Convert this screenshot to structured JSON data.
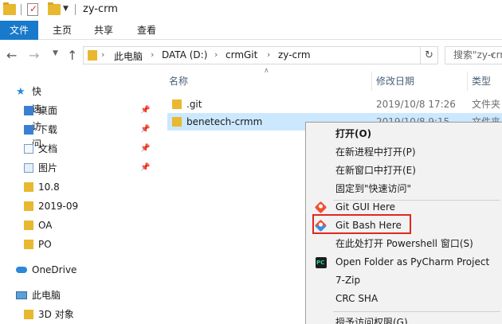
{
  "window": {
    "title": "zy-crm"
  },
  "ribbon": {
    "tabs": [
      "文件",
      "主页",
      "共享",
      "查看"
    ]
  },
  "address": {
    "crumbs": [
      "此电脑",
      "DATA (D:)",
      "crmGit",
      "zy-crm"
    ],
    "search_placeholder": "搜索\"zy-crm\""
  },
  "sidebar": {
    "quick_access": "快速访问",
    "items": [
      {
        "label": "桌面",
        "icon": "folder-blue-icon",
        "pinned": true
      },
      {
        "label": "下载",
        "icon": "download-folder-icon",
        "pinned": true
      },
      {
        "label": "文档",
        "icon": "documents-folder-icon",
        "pinned": true
      },
      {
        "label": "图片",
        "icon": "pictures-folder-icon",
        "pinned": true
      },
      {
        "label": "10.8",
        "icon": "folder-icon",
        "pinned": false
      },
      {
        "label": "2019-09",
        "icon": "folder-icon",
        "pinned": false
      },
      {
        "label": "OA",
        "icon": "folder-icon",
        "pinned": false
      },
      {
        "label": "PO",
        "icon": "folder-icon",
        "pinned": false
      }
    ],
    "onedrive": "OneDrive",
    "this_pc": "此电脑",
    "objects_3d": "3D 对象"
  },
  "columns": {
    "name": "名称",
    "date": "修改日期",
    "type": "类型"
  },
  "files": [
    {
      "name": ".git",
      "date": "2019/10/8 17:26",
      "type": "文件夹"
    },
    {
      "name": "benetech-crmm",
      "date": "2019/10/8 9:15",
      "type": "文件夹"
    }
  ],
  "context_menu": {
    "items": [
      {
        "label": "打开(O)",
        "icon": ""
      },
      {
        "label": "在新进程中打开(P)",
        "icon": ""
      },
      {
        "label": "在新窗口中打开(E)",
        "icon": ""
      },
      {
        "label": "固定到\"快速访问\"",
        "icon": ""
      },
      {
        "label": "Git GUI Here",
        "icon": "git-gui-icon"
      },
      {
        "label": "Git Bash Here",
        "icon": "git-bash-icon"
      },
      {
        "label": "在此处打开 Powershell 窗口(S)",
        "icon": ""
      },
      {
        "label": "Open Folder as PyCharm Project",
        "icon": "pycharm-icon"
      },
      {
        "label": "7-Zip",
        "icon": ""
      },
      {
        "label": "CRC SHA",
        "icon": ""
      },
      {
        "label": "授予访问权限(G)",
        "icon": ""
      }
    ]
  },
  "colors": {
    "accent": "#1979ca",
    "selection": "#cce8ff",
    "highlight_box": "#e0281e"
  }
}
